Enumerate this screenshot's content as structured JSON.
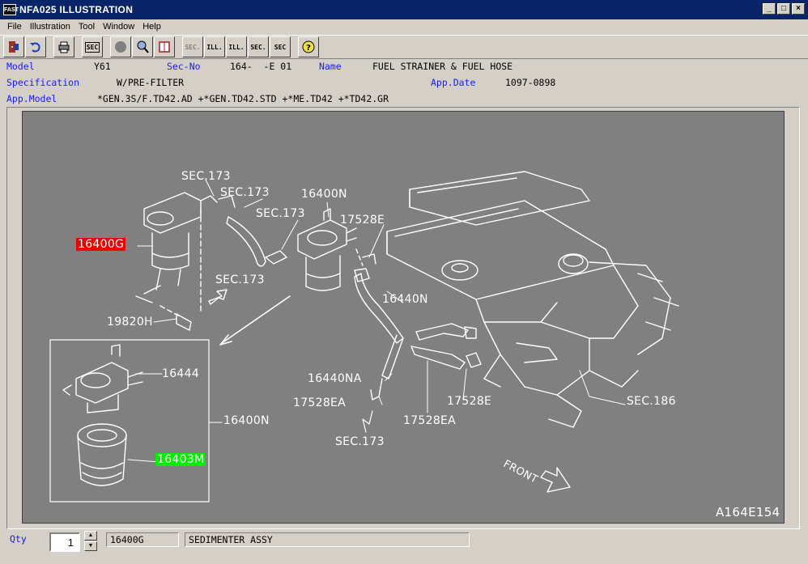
{
  "window": {
    "icon_text": "FAST",
    "title": "NFA025 ILLUSTRATION"
  },
  "menu": [
    "File",
    "Illustration",
    "Tool",
    "Window",
    "Help"
  ],
  "toolbar": {
    "icons": [
      "exit-icon",
      "undo-icon",
      "print-icon",
      "sec-icon",
      "circle-icon",
      "zoom-icon",
      "book-icon",
      "prev-sec-icon",
      "ill-first-icon",
      "ill-next-icon",
      "sec-list-icon",
      "sec-query-icon",
      "help-icon"
    ],
    "sec_text": "SEC",
    "ill_text": "ILL.",
    "sec2_text": "SEC."
  },
  "header": {
    "model_label": "Model",
    "model_value": "Y61",
    "secno_label": "Sec-No",
    "secno_value": "164-  -E 01",
    "name_label": "Name",
    "name_value": "FUEL STRAINER & FUEL HOSE",
    "spec_label": "Specification",
    "spec_value": "W/PRE-FILTER",
    "appdate_label": "App.Date",
    "appdate_value": "1097-0898",
    "appmodel_label": "App.Model",
    "appmodel_value": "*GEN.3S/F.TD42.AD +*GEN.TD42.STD +*ME.TD42 +*TD42.GR"
  },
  "illustration": {
    "id": "A164E154",
    "front_label": "FRONT",
    "labels": {
      "sec173_a": "SEC.173",
      "sec173_b": "SEC.173",
      "sec173_c": "SEC.173",
      "sec173_d": "SEC.173",
      "sec173_e": "SEC.173",
      "p16400n_top": "16400N",
      "p17528e_top": "17528E",
      "p16400g": "16400G",
      "p16440n": "16440N",
      "p19820h": "19820H",
      "p16444": "16444",
      "p16400n_box": "16400N",
      "p16440na": "16440NA",
      "p17528ea_left": "17528EA",
      "p17528e_bottom": "17528E",
      "p17528ea_bottom": "17528EA",
      "sec186": "SEC.186",
      "p16403m": "16403M"
    }
  },
  "status": {
    "qty_label": "Qty",
    "qty_value": "1",
    "part_number": "16400G",
    "part_name": "SEDIMENTER ASSY"
  }
}
